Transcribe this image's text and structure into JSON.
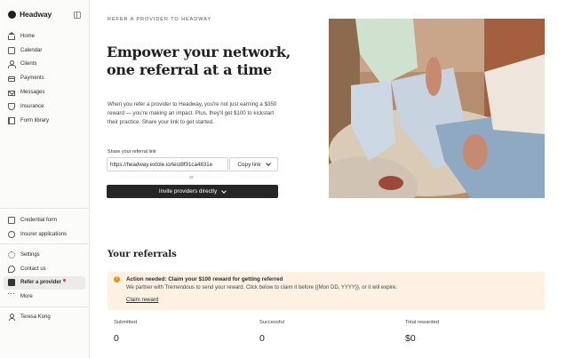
{
  "app": {
    "brand": "Headway"
  },
  "sidebar": {
    "primary": [
      {
        "label": "Home",
        "icon": "home-icon"
      },
      {
        "label": "Calendar",
        "icon": "calendar-icon"
      },
      {
        "label": "Clients",
        "icon": "clients-icon"
      },
      {
        "label": "Payments",
        "icon": "payments-icon"
      },
      {
        "label": "Messages",
        "icon": "messages-icon"
      },
      {
        "label": "Insurance",
        "icon": "insurance-icon"
      },
      {
        "label": "Form library",
        "icon": "form-library-icon"
      }
    ],
    "secondary": [
      {
        "label": "Credential form",
        "icon": "credential-form-icon"
      },
      {
        "label": "Insurer applications",
        "icon": "insurer-applications-icon"
      }
    ],
    "tertiary": [
      {
        "label": "Settings",
        "icon": "gear-icon"
      },
      {
        "label": "Contact us",
        "icon": "chat-icon"
      },
      {
        "label": "Refer a provider",
        "icon": "gift-icon",
        "active": true,
        "notification_dot": true
      },
      {
        "label": "More",
        "icon": "more-icon"
      }
    ],
    "user": {
      "name": "Teresa Kong"
    }
  },
  "main": {
    "eyebrow": "REFER A PROVIDER TO HEADWAY",
    "title_line1": "Empower your network,",
    "title_line2": "one referral at a time",
    "body": "When you refer a provider to Headway, you're not just earning a $350 reward — you're making an impact. Plus, they'll get $100 to kickstart their practice. Share your link to get started.",
    "share_label": "Share your referral link",
    "referral_link": "https://headway.extole.io/test8f91ca4831e",
    "copy_label": "Copy link",
    "or_text": "or",
    "invite_label": "Invite providers directly"
  },
  "referrals": {
    "title": "Your referrals",
    "banner": {
      "title": "Action needed: Claim your $100 reward for getting referred",
      "text": "We partner with Tremendous to send your reward. Click below to claim it before {{Mon DD, YYYY}}, or it will expire.",
      "link": "Claim reward"
    },
    "stats": [
      {
        "label": "Submitted",
        "value": "0"
      },
      {
        "label": "Successful",
        "value": "0"
      },
      {
        "label": "Total rewarded",
        "value": "$0"
      }
    ]
  },
  "colors": {
    "accent_dark": "#262626",
    "banner_bg": "#fdf1e3",
    "warning": "#e0941f",
    "notification": "#d9423a"
  }
}
